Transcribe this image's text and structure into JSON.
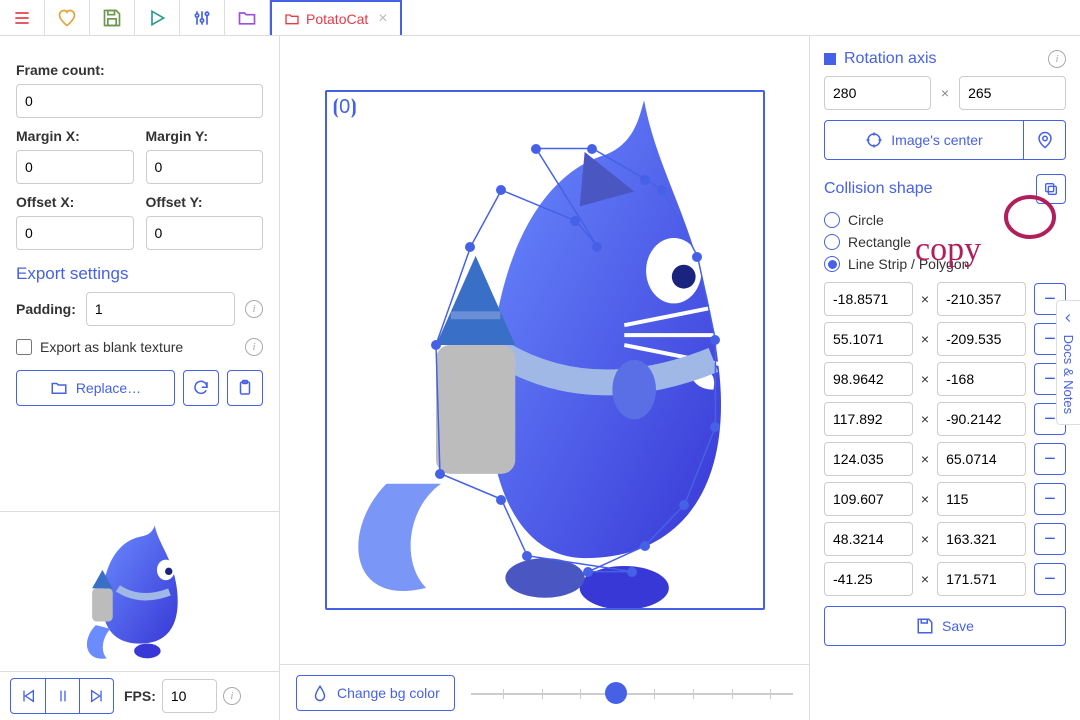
{
  "tab": {
    "name": "PotatoCat"
  },
  "left": {
    "frame_count_label": "Frame count:",
    "frame_count": "0",
    "margin_x_label": "Margin X:",
    "margin_y_label": "Margin Y:",
    "margin_x": "0",
    "margin_y": "0",
    "offset_x_label": "Offset X:",
    "offset_y_label": "Offset Y:",
    "offset_x": "0",
    "offset_y": "0",
    "export_header": "Export settings",
    "padding_label": "Padding:",
    "padding": "1",
    "blank_texture_label": "Export as blank texture",
    "replace_label": "Replace…",
    "fps_label": "FPS:",
    "fps": "10"
  },
  "center": {
    "zero": "⦗0⦘",
    "change_bg": "Change bg color"
  },
  "right": {
    "rot_axis": "Rotation axis",
    "rot_x": "280",
    "rot_y": "265",
    "center_btn": "Image's center",
    "collision": "Collision shape",
    "shapes": {
      "circle": "Circle",
      "rect": "Rectangle",
      "poly": "Line Strip / Polygon"
    },
    "coords": [
      {
        "x": "-18.8571",
        "y": "-210.357"
      },
      {
        "x": "55.1071",
        "y": "-209.535"
      },
      {
        "x": "98.9642",
        "y": "-168"
      },
      {
        "x": "117.892",
        "y": "-90.2142"
      },
      {
        "x": "124.035",
        "y": "65.0714"
      },
      {
        "x": "109.607",
        "y": "115"
      },
      {
        "x": "48.3214",
        "y": "163.321"
      },
      {
        "x": "-41.25",
        "y": "171.571"
      }
    ],
    "save": "Save"
  },
  "docs_tab": "Docs & Notes",
  "annotation": "copy"
}
